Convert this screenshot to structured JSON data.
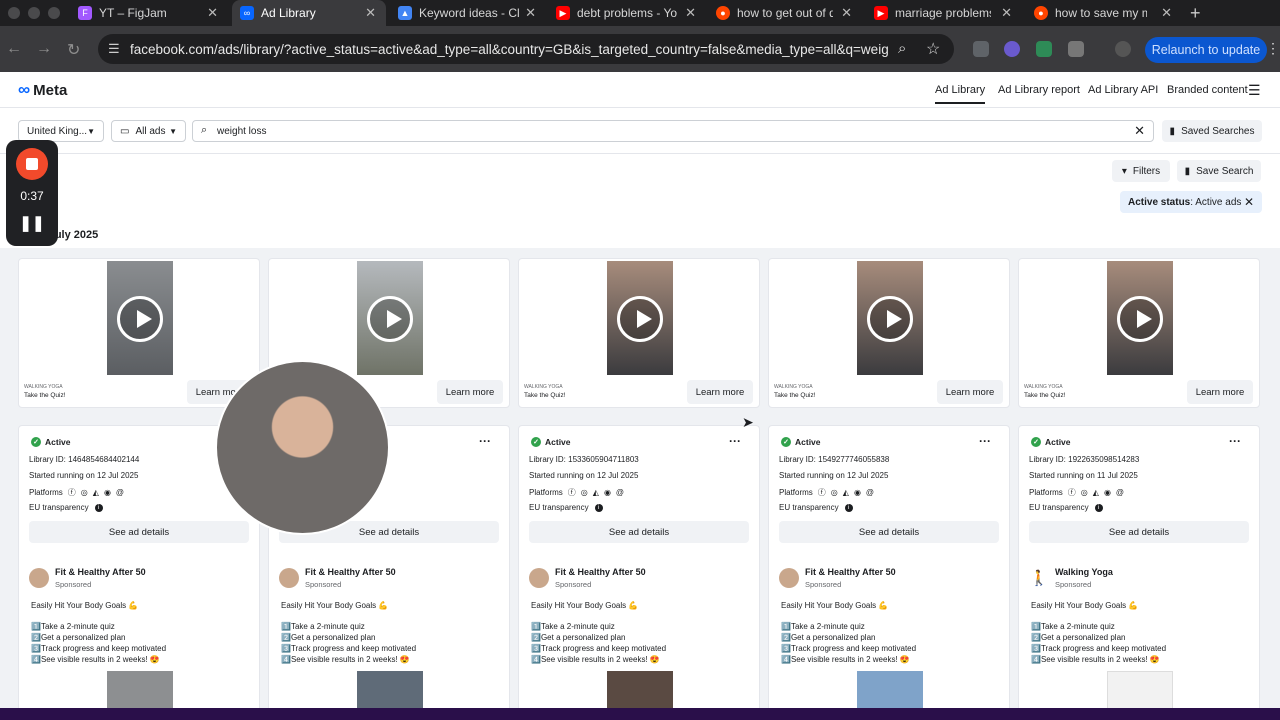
{
  "browser": {
    "tabs": [
      {
        "title": "YT – FigJam",
        "icon": "figma-icon",
        "color": "#a259ff"
      },
      {
        "title": "Ad Library",
        "icon": "meta-icon",
        "color": "#0866ff"
      },
      {
        "title": "Keyword ideas - Cli",
        "icon": "google-ads-icon",
        "color": "#4285f4"
      },
      {
        "title": "debt problems - Yo",
        "icon": "youtube-icon",
        "color": "#ff0000"
      },
      {
        "title": "how to get out of d",
        "icon": "reddit-icon",
        "color": "#ff4500"
      },
      {
        "title": "marriage problems",
        "icon": "youtube-icon",
        "color": "#ff0000"
      },
      {
        "title": "how to save my ma",
        "icon": "reddit-icon",
        "color": "#ff4500"
      }
    ],
    "url": "facebook.com/ads/library/?active_status=active&ad_type=all&country=GB&is_targeted_country=false&media_type=all&q=weig...",
    "relaunch_label": "Relaunch to update"
  },
  "header": {
    "logo": "Meta",
    "nav": [
      "Ad Library",
      "Ad Library report",
      "Ad Library API",
      "Branded content"
    ]
  },
  "search": {
    "country": "United King...",
    "ad_type": "All ads",
    "query": "weight loss",
    "saved_searches_label": "Saved Searches"
  },
  "filters": {
    "filters_label": "Filters",
    "save_search_label": "Save Search",
    "status_chip_key": "Active status",
    "status_chip_value": ": Active ads",
    "launched_text": "ed in July 2025"
  },
  "recorder": {
    "time": "0:37"
  },
  "top_cards": [
    {
      "brand": "WALKING YOGA",
      "caption": "Take the Quiz!",
      "cta": "Learn more"
    },
    {
      "brand": "",
      "caption": "",
      "cta": "Learn more"
    },
    {
      "brand": "WALKING YOGA",
      "caption": "Take the Quiz!",
      "cta": "Learn more"
    },
    {
      "brand": "WALKING YOGA",
      "caption": "Take the Quiz!",
      "cta": "Learn more"
    },
    {
      "brand": "WALKING YOGA",
      "caption": "Take the Quiz!",
      "cta": "Learn more"
    }
  ],
  "ad_cards": [
    {
      "status": "Active",
      "library_id": "Library ID: 1464854684402144",
      "started": "Started running on 12 Jul 2025",
      "advertiser": "Fit & Healthy After 50"
    },
    {
      "status": "",
      "library_id": "",
      "started": "",
      "advertiser": "Fit & Healthy After 50"
    },
    {
      "status": "Active",
      "library_id": "Library ID: 1533605904711803",
      "started": "Started running on 12 Jul 2025",
      "advertiser": "Fit & Healthy After 50"
    },
    {
      "status": "Active",
      "library_id": "Library ID: 1549277746055838",
      "started": "Started running on 12 Jul 2025",
      "advertiser": "Fit & Healthy After 50"
    },
    {
      "status": "Active",
      "library_id": "Library ID: 1922635098514283",
      "started": "Started running on 11 Jul 2025",
      "advertiser": "Walking Yoga"
    }
  ],
  "card_common": {
    "platforms_label": "Platforms",
    "eu_label": "EU transparency",
    "details_label": "See ad details",
    "sponsored": "Sponsored",
    "headline": "Easily Hit Your Body Goals 💪",
    "bullets": [
      "1️⃣Take a 2-minute quiz",
      "2️⃣Get a personalized plan",
      "3️⃣Track progress and keep motivated",
      "4️⃣See visible results in 2 weeks! 😍"
    ]
  }
}
